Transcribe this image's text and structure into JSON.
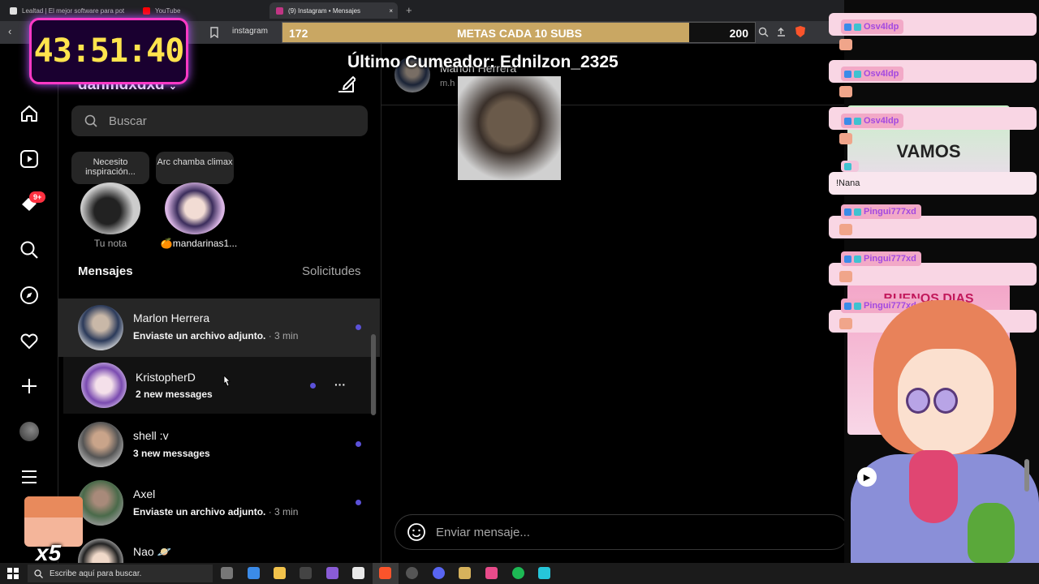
{
  "browser": {
    "tabs": [
      {
        "title": "Lealtad | El mejor software para pot",
        "color": "#e0e0e0"
      },
      {
        "title": "YouTube",
        "color": "#ff0000"
      },
      {
        "title": "(9) Instagram • Mensajes",
        "color": "#c13584"
      }
    ],
    "tab_close": "×",
    "new_tab": "+",
    "url": "instagram"
  },
  "overlay": {
    "timer": "43:51:40",
    "goal": {
      "current": "172",
      "label": "METAS CADA 10 SUBS",
      "target": "200",
      "progress_fraction": 0.86
    },
    "last_user": "Último Cumeador: Ednilzon_2325",
    "multiplier": "x5"
  },
  "sidebar": {
    "notifications_badge": "9+"
  },
  "inbox": {
    "username": "danmdxdxd",
    "search_placeholder": "Buscar",
    "notes": [
      {
        "bubble": "Necesito inspiración...",
        "label": "Tu nota"
      },
      {
        "bubble": "Arc chamba climax",
        "label": "🍊mandarinas1..."
      }
    ],
    "section_title": "Mensajes",
    "requests_label": "Solicitudes",
    "threads": [
      {
        "name": "Marlon Herrera",
        "preview": "Enviaste un archivo adjunto.",
        "time": "· 3 min",
        "unread": true
      },
      {
        "name": "KristopherD",
        "preview": "2 new messages",
        "time": "",
        "unread": true,
        "more": "···"
      },
      {
        "name": "shell :v",
        "preview": "3 new messages",
        "time": "",
        "unread": true
      },
      {
        "name": "Axel",
        "preview": "Enviaste un archivo adjunto.",
        "time": "· 3 min",
        "unread": true
      },
      {
        "name": "Nao 🪐",
        "preview": "",
        "time": "",
        "unread": false
      }
    ]
  },
  "conversation": {
    "name": "Marlon Herrera",
    "handle": "m.h",
    "composer_placeholder": "Enviar mensaje..."
  },
  "chat": [
    {
      "user": "Osv4ldp",
      "message": ""
    },
    {
      "user": "Osv4ldp",
      "message": ""
    },
    {
      "user": "Osv4ldp",
      "message": ""
    },
    {
      "user": "",
      "message": "!Nana"
    },
    {
      "user": "Pingui777xd",
      "message": ""
    },
    {
      "user": "Pingui777xd",
      "message": ""
    },
    {
      "user": "Pingui777xd",
      "message": ""
    }
  ],
  "chat_card_text": {
    "top": "VAMOS",
    "bottom": "BUENOS DIAS"
  },
  "taskbar": {
    "search_placeholder": "Escribe aquí para buscar."
  },
  "colors": {
    "unread_dot": "#5b51d8",
    "timer_text": "#ffe44d",
    "timer_glow": "#ff39c6",
    "goal_fill": "#c9a763",
    "chat_bg": "#f9d6e4",
    "chat_name": "#f2a9c7"
  }
}
